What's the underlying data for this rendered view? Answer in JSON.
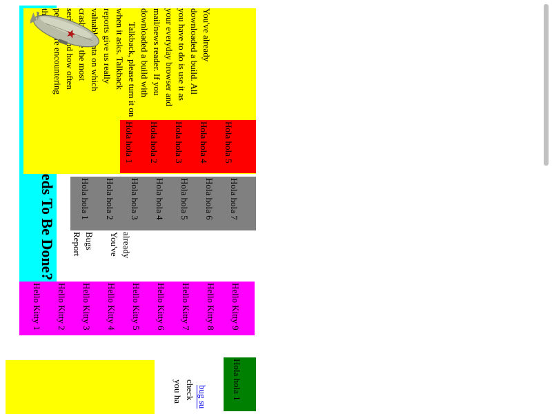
{
  "heading": "What Needs To Be Done?",
  "body": {
    "paragraph1_lines": [
      "You've already",
      "downloaded a build.  All",
      "you have to do is use it as",
      "your everyday browser and",
      "mail/news reader.  If you",
      "downloaded a build with",
      "Talkback, please turn it on"
    ],
    "paragraph2_lines": [
      "when it asks.  Talkback",
      "reports give us really",
      "valuable data on which",
      "crashes are the most",
      "serious, and how often",
      "people are encountering",
      "them."
    ]
  },
  "red_items": [
    "Hola hola 1",
    "Hola hola 2",
    "Hola hola 3",
    "Hola hola 4",
    "Hola hola 5"
  ],
  "gray_items": [
    "Hola hola 1",
    "Hola hola 2",
    "Hola hola 3",
    "Hola hola 4",
    "Hola hola 5",
    "Hola hola 6",
    "Hola hola 7"
  ],
  "words": [
    "Report",
    "Bugs",
    "You've",
    "already"
  ],
  "kitty_items": [
    "Hello Kitty 1",
    "Hello Kitty 2",
    "Hello Kitty 3",
    "Hello Kitty 4",
    "Hello Kitty 5",
    "Hello Kitty 6",
    "Hello Kitty 7",
    "Hello Kitty 8",
    "Hello Kitty 9"
  ],
  "green_item": "Hola hola 1",
  "bottom_lines": {
    "line1": "you ha",
    "line2": "check",
    "link": "bug su"
  },
  "colors": {
    "cyan": "#00ffff",
    "yellow": "#ffff00",
    "red": "#ff0000",
    "gray": "#808080",
    "magenta": "#ff00ff",
    "green": "#008000"
  },
  "icons": {
    "blimp": "zeppelin-image"
  }
}
